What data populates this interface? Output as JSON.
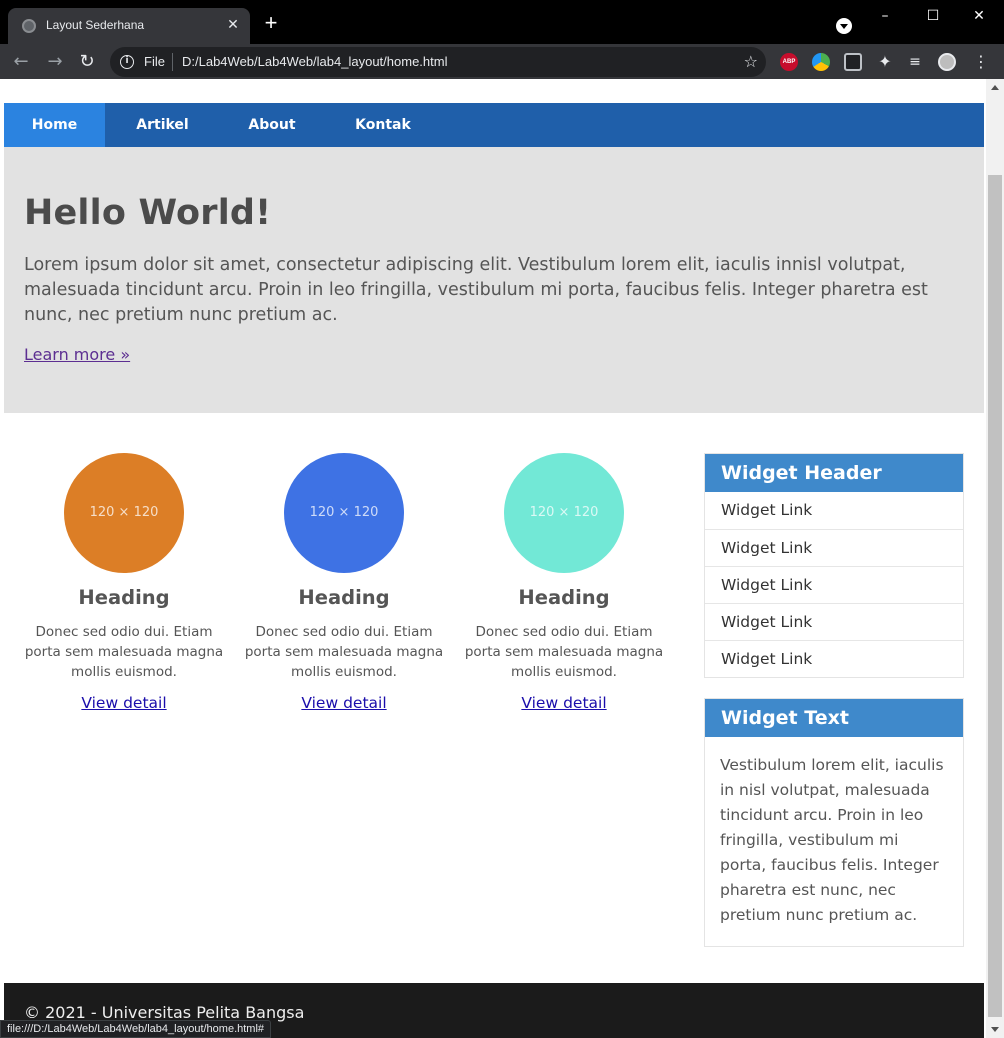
{
  "browser": {
    "tab_title": "Layout Sederhana",
    "tab_close": "✕",
    "new_tab": "+",
    "address_scheme": "File",
    "address_url": "D:/Lab4Web/Lab4Web/lab4_layout/home.html",
    "status_url": "file:///D:/Lab4Web/Lab4Web/lab4_layout/home.html#",
    "ext_abp": "ABP"
  },
  "nav": {
    "items": [
      "Home",
      "Artikel",
      "About",
      "Kontak"
    ]
  },
  "hero": {
    "title": "Hello World!",
    "text": "Lorem ipsum dolor sit amet, consectetur adipiscing elit. Vestibulum lorem elit, iaculis innisl volutpat, malesuada tincidunt arcu. Proin in leo fringilla, vestibulum mi porta, faucibus felis. Integer pharetra est nunc, nec pretium nunc pretium ac.",
    "link": "Learn more »"
  },
  "features": [
    {
      "image_label": "120 × 120",
      "color": "#dc7e26",
      "heading": "Heading",
      "text": "Donec sed odio dui. Etiam porta sem malesuada magna mollis euismod.",
      "link": "View detail"
    },
    {
      "image_label": "120 × 120",
      "color": "#3e72e4",
      "heading": "Heading",
      "text": "Donec sed odio dui. Etiam porta sem malesuada magna mollis euismod.",
      "link": "View detail"
    },
    {
      "image_label": "120 × 120",
      "color": "#72e8d6",
      "heading": "Heading",
      "text": "Donec sed odio dui. Etiam porta sem malesuada magna mollis euismod.",
      "link": "View detail"
    }
  ],
  "widget_links": {
    "header": "Widget Header",
    "items": [
      "Widget Link",
      "Widget Link",
      "Widget Link",
      "Widget Link",
      "Widget Link"
    ]
  },
  "widget_text": {
    "header": "Widget Text",
    "body": "Vestibulum lorem elit, iaculis in nisl volutpat, malesuada tincidunt arcu. Proin in leo fringilla, vestibulum mi porta, faucibus felis. Integer pharetra est nunc, nec pretium nunc pretium ac."
  },
  "footer": {
    "text": "© 2021 - Universitas Pelita Bangsa"
  },
  "colors": {
    "nav_bg": "#1f5faa",
    "nav_active": "#2b83e0",
    "widget_header": "#3f89cb",
    "hero_bg": "#e2e2e2",
    "footer_bg": "#1b1b1b"
  }
}
